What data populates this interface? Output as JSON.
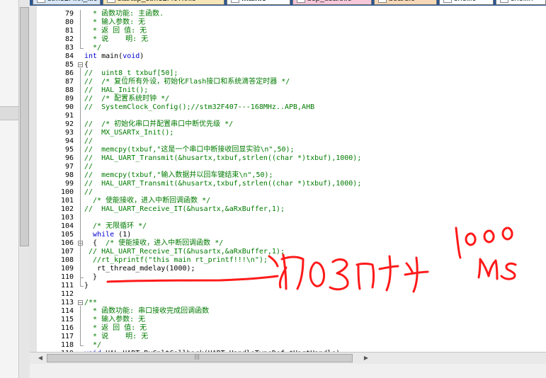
{
  "tabs": [
    {
      "label": "stm32f4xx_it.c",
      "active": false,
      "color": "#d6e6f7"
    },
    {
      "label": "startup_stm32f407xx.s",
      "active": false,
      "color": "#f7e6b8"
    },
    {
      "label": "main.c",
      "active": true,
      "color": "#ffffff"
    },
    {
      "label": "bsp_usartx.c",
      "active": false,
      "color": "#f7c8d8"
    },
    {
      "label": "board.c",
      "active": false,
      "color": "#f7d9b8"
    },
    {
      "label": "shell.c",
      "active": false,
      "color": "#ffffff"
    },
    {
      "label": "shell.h",
      "active": false,
      "color": "#ffffff"
    }
  ],
  "lines": [
    {
      "n": "79",
      "text": "  * 函数功能: 主函数.",
      "cls": "cm",
      "fold": "",
      "indent": 0
    },
    {
      "n": "80",
      "text": "  * 输入参数: 无",
      "cls": "cm",
      "fold": "",
      "indent": 0
    },
    {
      "n": "81",
      "text": "  * 返 回 值: 无",
      "cls": "cm",
      "fold": "",
      "indent": 0
    },
    {
      "n": "82",
      "text": "  * 说    明: 无",
      "cls": "cm",
      "fold": "",
      "indent": 0
    },
    {
      "n": "83",
      "text": "  */",
      "cls": "cm",
      "fold": "end",
      "indent": 0
    },
    {
      "n": "84",
      "text": "int main(void)",
      "cls": "kwline",
      "fold": "",
      "indent": 0
    },
    {
      "n": "85",
      "text": "{",
      "cls": "",
      "fold": "box",
      "indent": 0
    },
    {
      "n": "86",
      "text": "//  uint8_t txbuf[50];",
      "cls": "cm",
      "fold": "",
      "indent": 0
    },
    {
      "n": "87",
      "text": "//  /* 复位所有外设，初始化Flash接口和系统滴答定时器 */",
      "cls": "cm",
      "fold": "",
      "indent": 0
    },
    {
      "n": "88",
      "text": "//  HAL_Init();",
      "cls": "cm",
      "fold": "",
      "indent": 0
    },
    {
      "n": "89",
      "text": "//  /* 配置系统时钟 */",
      "cls": "cm",
      "fold": "",
      "indent": 0
    },
    {
      "n": "90",
      "text": "//  SystemClock_Config();//stm32F407---168MHz..APB,AHB",
      "cls": "cm",
      "fold": "",
      "indent": 0
    },
    {
      "n": "91",
      "text": "",
      "cls": "",
      "fold": "",
      "indent": 0
    },
    {
      "n": "92",
      "text": "//  /* 初始化串口并配置串口中断优先级 */",
      "cls": "cm",
      "fold": "",
      "indent": 0
    },
    {
      "n": "93",
      "text": "//  MX_USARTx_Init();",
      "cls": "cm",
      "fold": "",
      "indent": 0
    },
    {
      "n": "94",
      "text": "//",
      "cls": "cm",
      "fold": "",
      "indent": 0
    },
    {
      "n": "95",
      "text": "//  memcpy(txbuf,\"这是一个串口中断接收回显实验\\n\",50);",
      "cls": "cm",
      "fold": "",
      "indent": 0
    },
    {
      "n": "96",
      "text": "//  HAL_UART_Transmit(&husartx,txbuf,strlen((char *)txbuf),1000);",
      "cls": "cm",
      "fold": "",
      "indent": 0
    },
    {
      "n": "97",
      "text": "//",
      "cls": "cm",
      "fold": "",
      "indent": 0
    },
    {
      "n": "98",
      "text": "//  memcpy(txbuf,\"输入数据并以回车键结束\\n\",50);",
      "cls": "cm",
      "fold": "",
      "indent": 0
    },
    {
      "n": "99",
      "text": "//  HAL_UART_Transmit(&husartx,txbuf,strlen((char *)txbuf),1000);",
      "cls": "cm",
      "fold": "",
      "indent": 0
    },
    {
      "n": "100",
      "text": "//",
      "cls": "cm",
      "fold": "",
      "indent": 0
    },
    {
      "n": "101",
      "text": "  /* 使能接收，进入中断回调函数 */",
      "cls": "cm",
      "fold": "",
      "indent": 0
    },
    {
      "n": "102",
      "text": "//  HAL_UART_Receive_IT(&husartx,&aRxBuffer,1);",
      "cls": "cm",
      "fold": "",
      "indent": 0
    },
    {
      "n": "103",
      "text": "",
      "cls": "",
      "fold": "",
      "indent": 0
    },
    {
      "n": "104",
      "text": "  /* 无限循环 */",
      "cls": "cm",
      "fold": "",
      "indent": 0
    },
    {
      "n": "105",
      "text": "  while (1)",
      "cls": "kwline",
      "fold": "",
      "indent": 0
    },
    {
      "n": "106",
      "text": "  {  /* 使能接收，进入中断回调函数 */",
      "cls": "mix",
      "fold": "box",
      "indent": 0
    },
    {
      "n": "107",
      "text": " // HAL_UART_Receive_IT(&husartx,&aRxBuffer,1);",
      "cls": "cm",
      "fold": "",
      "indent": 0
    },
    {
      "n": "108",
      "text": "  //rt_kprintf(\"this main rt_printf!!!\\n\");",
      "cls": "cm",
      "fold": "",
      "indent": 0
    },
    {
      "n": "109",
      "text": "   rt_thread_mdelay(1000);",
      "cls": "",
      "fold": "",
      "indent": 0
    },
    {
      "n": "110",
      "text": "  }",
      "cls": "",
      "fold": "end",
      "indent": 0
    },
    {
      "n": "111",
      "text": "}",
      "cls": "",
      "fold": "end",
      "indent": 0
    },
    {
      "n": "112",
      "text": "",
      "cls": "",
      "fold": "",
      "indent": 0
    },
    {
      "n": "113",
      "text": "/**",
      "cls": "cm",
      "fold": "box",
      "indent": 0
    },
    {
      "n": "114",
      "text": "  * 函数功能: 串口接收完成回调函数",
      "cls": "cm",
      "fold": "",
      "indent": 0
    },
    {
      "n": "115",
      "text": "  * 输入参数: 无",
      "cls": "cm",
      "fold": "",
      "indent": 0
    },
    {
      "n": "116",
      "text": "  * 返 回 值: 无",
      "cls": "cm",
      "fold": "",
      "indent": 0
    },
    {
      "n": "117",
      "text": "  * 说    明: 无",
      "cls": "cm",
      "fold": "",
      "indent": 0
    },
    {
      "n": "118",
      "text": "  */",
      "cls": "cm",
      "fold": "end",
      "indent": 0
    },
    {
      "n": "119",
      "text": "void HAL_UART_RxCpltCallback(UART_HandleTypeDef *UartHandle)",
      "cls": "kwline",
      "fold": "",
      "indent": 0
    }
  ],
  "colors": {
    "comment": "#007a00",
    "keyword": "#0000d0",
    "ink": "#ff1a1a",
    "tabbar": "#2b5690"
  },
  "scrollbar": {
    "left_arrow": "◀",
    "right_arrow": "▶",
    "grip": "|||"
  }
}
